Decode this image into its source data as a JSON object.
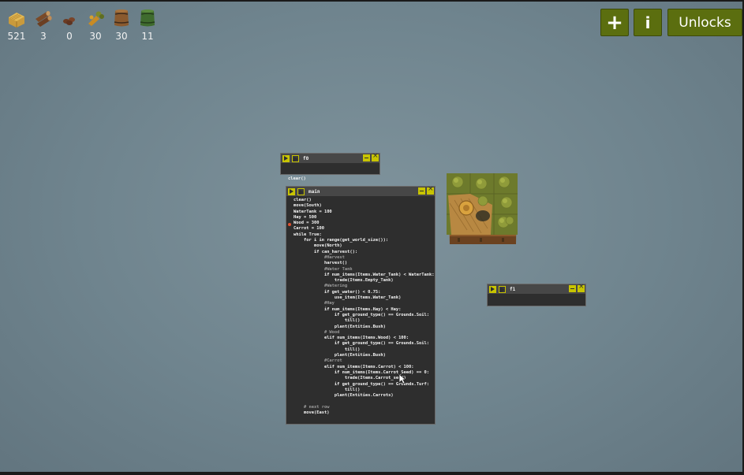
{
  "resources": [
    {
      "icon": "hay-icon",
      "count": "521"
    },
    {
      "icon": "wood-icon",
      "count": "3"
    },
    {
      "icon": "carrot-icon",
      "count": "0"
    },
    {
      "icon": "carrot-seed-icon",
      "count": "30"
    },
    {
      "icon": "empty-tank-icon",
      "count": "30"
    },
    {
      "icon": "water-tank-icon",
      "count": "11"
    }
  ],
  "toolbar": {
    "add_label": "+",
    "info_label": "i",
    "unlocks_label": "Unlocks"
  },
  "windows": {
    "f0": {
      "title": "f0",
      "code": [
        "clear()"
      ]
    },
    "main": {
      "title": "main",
      "code": [
        "clear()",
        "move(South)",
        "WaterTank = 100",
        "Hay = 500",
        "Wood = 300",
        "Carrot = 100",
        "while True:",
        "    for i in range(get_world_size()):",
        "        move(North)",
        "        if can_harvest():",
        "            #Harvest",
        "            harvest()",
        "            #Water Tank",
        "            if num_items(Items.Water_Tank) < WaterTank:",
        "                trade(Items.Empty_Tank)",
        "            #Watering",
        "            if get_water() < 0.75:",
        "                use_item(Items.Water_Tank)",
        "            #Hay",
        "            if num_items(Items.Hay) < Hay:",
        "                if get_ground_type() == Grounds.Soil:",
        "                    till()",
        "                plant(Entities.Bush)",
        "            # Wood",
        "            elif num_items(Items.Wood) < 100:",
        "                if get_ground_type() == Grounds.Soil:",
        "                    till()",
        "                plant(Entities.Bush)",
        "            #Carrot",
        "            elif num_items(Items.Carrot) < 100:",
        "                if num_items(Items.Carrot_Seed) == 0:",
        "                    trade(Items.Carrot_seed)",
        "                if get_ground_type() == Grounds.Turf:",
        "                    till()",
        "                plant(Entities.Carrots)",
        "",
        "    # next row",
        "    move(East)"
      ]
    },
    "f1": {
      "title": "f1",
      "code": []
    }
  },
  "colors": {
    "button_green": "#5b6e0f",
    "window_yellow": "#c8c400",
    "keyword_orange": "#e8a33c",
    "comment_gray": "#9a9a9a"
  }
}
